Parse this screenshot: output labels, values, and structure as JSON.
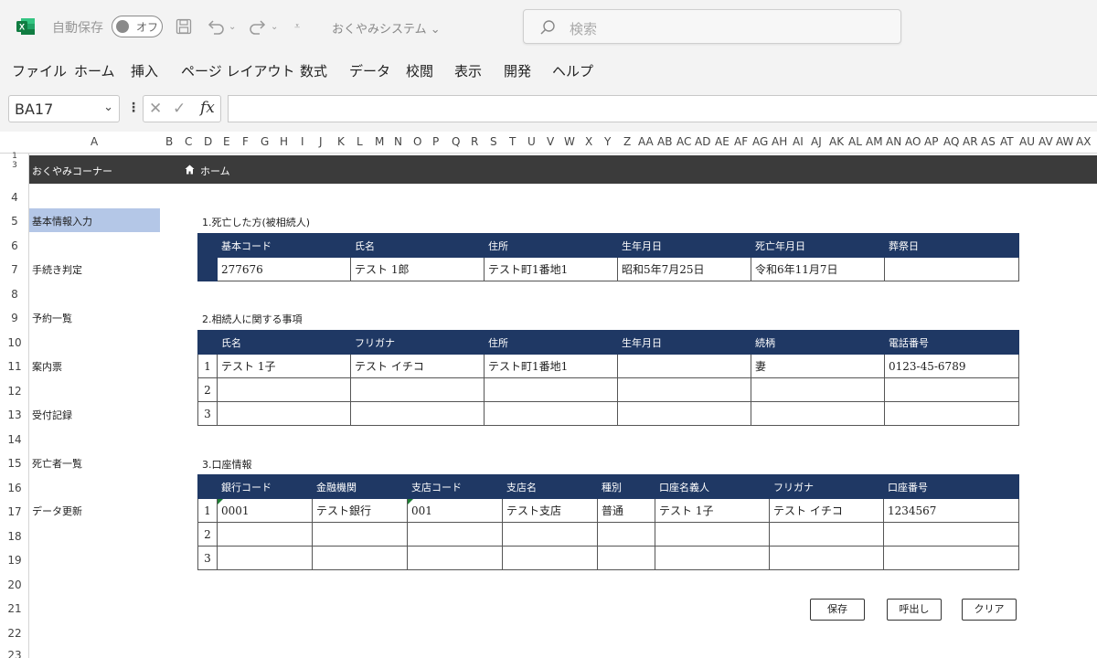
{
  "titlebar": {
    "autosave_label": "自動保存",
    "autosave_state": "オフ",
    "doc_title": "おくやみシステム",
    "search_placeholder": "検索"
  },
  "menu": [
    "ファイル",
    "ホーム",
    "挿入",
    "ページ レイアウト",
    "数式",
    "データ",
    "校閲",
    "表示",
    "開発",
    "ヘルプ"
  ],
  "formula_bar": {
    "name_box": "BA17",
    "formula": ""
  },
  "columns": [
    "A",
    "B",
    "C",
    "D",
    "E",
    "F",
    "G",
    "H",
    "I",
    "J",
    "K",
    "L",
    "M",
    "N",
    "O",
    "P",
    "Q",
    "R",
    "S",
    "T",
    "U",
    "V",
    "W",
    "X",
    "Y",
    "Z",
    "AA",
    "AB",
    "AC",
    "AD",
    "AE",
    "AF",
    "AG",
    "AH",
    "AI",
    "AJ",
    "AK",
    "AL",
    "AM",
    "AN",
    "AO",
    "AP",
    "AQ",
    "AR",
    "AS",
    "AT",
    "AU",
    "AV",
    "AW",
    "AX"
  ],
  "rows": [
    "1",
    "3",
    "4",
    "5",
    "6",
    "7",
    "8",
    "9",
    "10",
    "11",
    "12",
    "13",
    "14",
    "15",
    "16",
    "17",
    "18",
    "19",
    "20",
    "21",
    "22",
    "23"
  ],
  "app": {
    "title": "おくやみコーナー",
    "home_label": "ホーム"
  },
  "nav": [
    {
      "label": "基本情報入力",
      "active": true
    },
    {
      "label": "手続き判定",
      "active": false
    },
    {
      "label": "予約一覧",
      "active": false
    },
    {
      "label": "案内票",
      "active": false
    },
    {
      "label": "受付記録",
      "active": false
    },
    {
      "label": "死亡者一覧",
      "active": false
    },
    {
      "label": "データ更新",
      "active": false
    }
  ],
  "section1": {
    "title": "1.死亡した方(被相続人)",
    "headers": [
      "基本コード",
      "氏名",
      "住所",
      "生年月日",
      "死亡年月日",
      "葬祭日"
    ],
    "row": [
      "277676",
      "テスト 1郎",
      "テスト町1番地1",
      "昭和5年7月25日",
      "令和6年11月7日",
      ""
    ]
  },
  "section2": {
    "title": "2.相続人に関する事項",
    "headers": [
      "氏名",
      "フリガナ",
      "住所",
      "生年月日",
      "続柄",
      "電話番号"
    ],
    "rows": [
      {
        "idx": "1",
        "cells": [
          "テスト 1子",
          "テスト イチコ",
          "テスト町1番地1",
          "",
          "妻",
          "0123-45-6789"
        ]
      },
      {
        "idx": "2",
        "cells": [
          "",
          "",
          "",
          "",
          "",
          ""
        ]
      },
      {
        "idx": "3",
        "cells": [
          "",
          "",
          "",
          "",
          "",
          ""
        ]
      }
    ]
  },
  "section3": {
    "title": "3.口座情報",
    "headers": [
      "銀行コード",
      "金融機関",
      "支店コード",
      "支店名",
      "種別",
      "口座名義人",
      "フリガナ",
      "口座番号"
    ],
    "rows": [
      {
        "idx": "1",
        "cells": [
          "0001",
          "テスト銀行",
          "001",
          "テスト支店",
          "普通",
          "テスト 1子",
          "テスト イチコ",
          "1234567"
        ]
      },
      {
        "idx": "2",
        "cells": [
          "",
          "",
          "",
          "",
          "",
          "",
          "",
          ""
        ]
      },
      {
        "idx": "3",
        "cells": [
          "",
          "",
          "",
          "",
          "",
          "",
          "",
          ""
        ]
      }
    ]
  },
  "buttons": {
    "save": "保存",
    "load": "呼出し",
    "clear": "クリア"
  },
  "colors": {
    "table_header": "#1f3864",
    "nav_active": "#b4c7e7",
    "app_header": "#3b3b3b",
    "excel_green": "#1e7e34"
  }
}
